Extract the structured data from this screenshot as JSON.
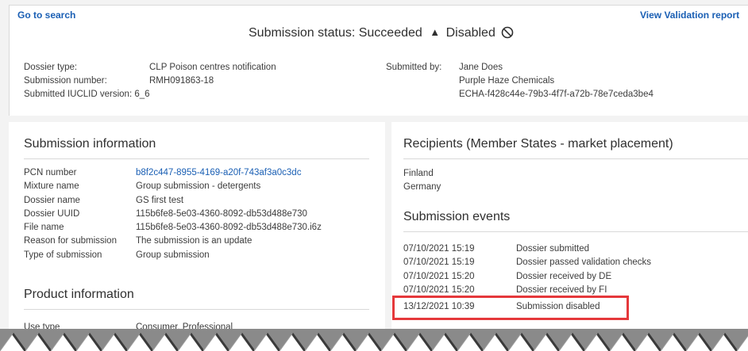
{
  "header": {
    "go_to_search": "Go to search",
    "view_validation_report": "View Validation report",
    "status_label": "Submission status:",
    "status_value": "Succeeded",
    "status_secondary": "Disabled"
  },
  "dossier_meta": {
    "dossier_type_label": "Dossier type:",
    "dossier_type_value": "CLP Poison centres notification",
    "submission_number_label": "Submission number:",
    "submission_number_value": "RMH091863-18",
    "iuclid_label": "Submitted IUCLID version:",
    "iuclid_value": "6_6",
    "submitted_by_label": "Submitted by:",
    "submitted_by_name": "Jane Does",
    "submitted_by_company": "Purple Haze Chemicals",
    "submitted_by_id": "ECHA-f428c44e-79b3-4f7f-a72b-78e7ceda3be4"
  },
  "submission_info": {
    "title": "Submission information",
    "rows": [
      {
        "label": "PCN number",
        "value": "b8f2c447-8955-4169-a20f-743af3a0c3dc"
      },
      {
        "label": "Mixture name",
        "value": "Group submission - detergents"
      },
      {
        "label": "Dossier name",
        "value": "GS first test"
      },
      {
        "label": "Dossier UUID",
        "value": "115b6fe8-5e03-4360-8092-db53d488e730"
      },
      {
        "label": "File name",
        "value": "115b6fe8-5e03-4360-8092-db53d488e730.i6z"
      },
      {
        "label": "Reason for submission",
        "value": "The submission is an update"
      },
      {
        "label": "Type of submission",
        "value": "Group submission"
      }
    ]
  },
  "product_info": {
    "title": "Product information",
    "rows": [
      {
        "label": "Use type",
        "value": "Consumer, Professional"
      }
    ]
  },
  "recipients": {
    "title": "Recipients (Member States - market placement)",
    "items": [
      "Finland",
      "Germany"
    ]
  },
  "events": {
    "title": "Submission events",
    "rows": [
      {
        "date": "07/10/2021 15:19",
        "event": "Dossier submitted"
      },
      {
        "date": "07/10/2021 15:19",
        "event": "Dossier passed validation checks"
      },
      {
        "date": "07/10/2021 15:20",
        "event": "Dossier received by DE"
      },
      {
        "date": "07/10/2021 15:20",
        "event": "Dossier received by FI"
      },
      {
        "date": "13/12/2021 10:39",
        "event": "Submission disabled"
      }
    ]
  },
  "colors": {
    "link": "#1a5fb4",
    "highlight": "#e5383b",
    "page_bg": "#f3f3f3"
  }
}
